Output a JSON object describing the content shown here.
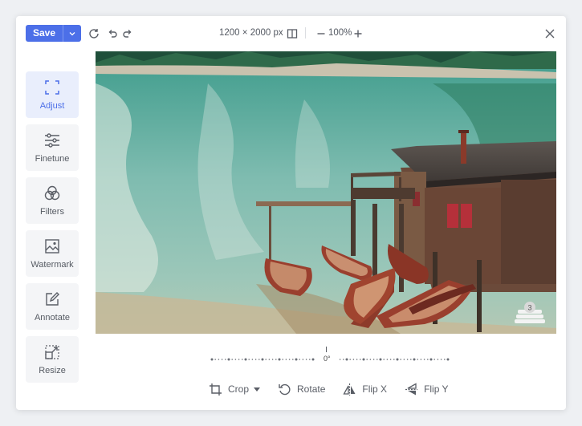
{
  "toolbar": {
    "save_label": "Save",
    "image_size": "1200 × 2000 px",
    "zoom": "100%"
  },
  "sidebar": {
    "items": [
      {
        "label": "Adjust",
        "icon": "crop-corners-icon",
        "active": true
      },
      {
        "label": "Finetune",
        "icon": "sliders-icon",
        "active": false
      },
      {
        "label": "Filters",
        "icon": "overlapping-circles-icon",
        "active": false
      },
      {
        "label": "Watermark",
        "icon": "image-frame-icon",
        "active": false
      },
      {
        "label": "Annotate",
        "icon": "pencil-square-icon",
        "active": false
      },
      {
        "label": "Resize",
        "icon": "resize-icon",
        "active": false
      }
    ]
  },
  "rotation": {
    "angle_label": "0°"
  },
  "tools": {
    "crop_label": "Crop",
    "rotate_label": "Rotate",
    "flip_x_label": "Flip X",
    "flip_y_label": "Flip Y"
  },
  "photo": {
    "badge_count": "3"
  },
  "colors": {
    "accent": "#4c6fe8",
    "active_bg": "#e9eefc"
  }
}
